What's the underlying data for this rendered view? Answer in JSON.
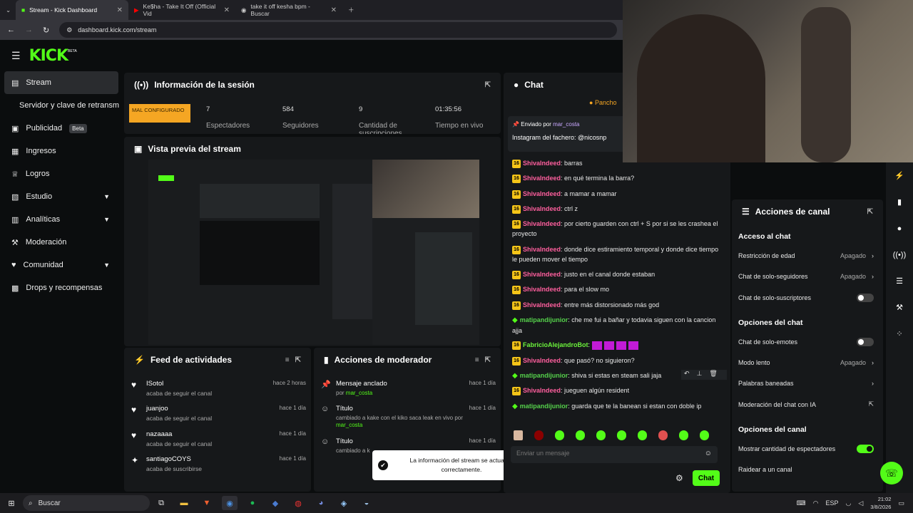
{
  "browser": {
    "tabs": [
      {
        "label": "Stream - Kick Dashboard",
        "active": true
      },
      {
        "label": "Ke$ha - Take It Off (Official Vid",
        "active": false
      },
      {
        "label": "take it off kesha bpm - Buscar",
        "active": false
      }
    ],
    "url": "dashboard.kick.com/stream"
  },
  "brand": {
    "logo": "KICK",
    "beta": "BETA",
    "accent": "#53fc18"
  },
  "sidebar": {
    "items": [
      {
        "label": "Stream",
        "icon": "stream-icon",
        "active": true
      },
      {
        "label": "Servidor y clave de retransm",
        "icon": "",
        "active": false
      },
      {
        "label": "Publicidad",
        "icon": "ad-icon",
        "badge": "Beta"
      },
      {
        "label": "Ingresos",
        "icon": "revenue-icon"
      },
      {
        "label": "Logros",
        "icon": "trophy-icon"
      },
      {
        "label": "Estudio",
        "icon": "studio-icon",
        "expand": true
      },
      {
        "label": "Analíticas",
        "icon": "analytics-icon",
        "expand": true
      },
      {
        "label": "Moderación",
        "icon": "mod-icon"
      },
      {
        "label": "Comunidad",
        "icon": "community-icon",
        "expand": true
      },
      {
        "label": "Drops y recompensas",
        "icon": "drops-icon"
      }
    ]
  },
  "session": {
    "title": "Información de la sesión",
    "warning": "MAL CONFIGURADO",
    "stats": [
      {
        "value": "7",
        "label": "Espectadores"
      },
      {
        "value": "584",
        "label": "Seguidores"
      },
      {
        "value": "9",
        "label": "Cantidad de suscripciones"
      },
      {
        "value": "01:35:56",
        "label": "Tiempo en vivo"
      }
    ]
  },
  "preview": {
    "title": "Vista previa del stream"
  },
  "feed": {
    "title": "Feed de actividades",
    "items": [
      {
        "name": "ISotol",
        "sub": "acaba de seguir el canal",
        "time": "hace 2 horas",
        "icon": "heart-icon"
      },
      {
        "name": "juanjoo",
        "sub": "acaba de seguir el canal",
        "time": "hace 1 día",
        "icon": "heart-icon"
      },
      {
        "name": "nazaaaa",
        "sub": "acaba de seguir el canal",
        "time": "hace 1 día",
        "icon": "heart-icon"
      },
      {
        "name": "santiagoCOYS",
        "sub": "acaba de suscribirse",
        "time": "hace 1 día",
        "icon": "star-icon"
      }
    ]
  },
  "mod_actions": {
    "title": "Acciones de moderador",
    "items": [
      {
        "name": "Mensaje anclado",
        "sub": "por",
        "user": "mar_costa",
        "time": "hace 1 día"
      },
      {
        "name": "Título",
        "sub": "cambiado a kake con el kiko saca leak en vivo por",
        "user": "mar_costa",
        "time": "hace 1 día"
      },
      {
        "name": "Título",
        "sub": "cambiado a k",
        "user": "",
        "time": "hace 1 día"
      }
    ]
  },
  "toast": {
    "text": "La información del stream se actualizó correctamente."
  },
  "chat": {
    "title": "Chat",
    "pinned_by_label": "Enviado por",
    "pinned_user": "mar_costa",
    "pinned_text": "Instagram del fachero: @nicosnp",
    "top_user": "Pancho",
    "messages": [
      {
        "badge": "16",
        "user": "ShivaIndeed",
        "text": "barras"
      },
      {
        "badge": "16",
        "user": "ShivaIndeed",
        "text": "en qué termina la barra?"
      },
      {
        "badge": "16",
        "user": "ShivaIndeed",
        "text": "a mamar a mamar"
      },
      {
        "badge": "16",
        "user": "ShivaIndeed",
        "text": "ctrl z"
      },
      {
        "badge": "16",
        "user": "ShivaIndeed",
        "text": "por cierto guarden con ctrl + S por si se les crashea el proyecto"
      },
      {
        "badge": "16",
        "user": "ShivaIndeed",
        "text": "donde dice estiramiento temporal y donde dice tiempo le pueden mover el tiempo"
      },
      {
        "badge": "16",
        "user": "ShivaIndeed",
        "text": "justo en el canal donde estaban"
      },
      {
        "badge": "16",
        "user": "ShivaIndeed",
        "text": "para el slow mo"
      },
      {
        "badge": "16",
        "user": "ShivaIndeed",
        "text": "entre más distorsionado más god"
      },
      {
        "badge": "dia",
        "user": "matipandijunior",
        "text": "che me fui a bañar y todavia siguen con la cancion ajja"
      },
      {
        "badge": "16",
        "user": "FabricioAlejandroBot",
        "text": ""
      },
      {
        "badge": "16",
        "user": "ShivaIndeed",
        "text": "que pasó? no siguieron?"
      },
      {
        "badge": "dia",
        "user": "matipandijunior",
        "text": "shiva si estas en steam sali jaja"
      },
      {
        "badge": "16",
        "user": "ShivaIndeed",
        "text": "jueguen algún resident"
      },
      {
        "badge": "dia",
        "user": "matipandijunior",
        "text": "guarda que te la banean si estan con doble ip"
      }
    ],
    "input_placeholder": "Enviar un mensaje",
    "send_label": "Chat"
  },
  "channel_actions": {
    "title": "Acciones de canal",
    "sections": [
      {
        "header": "Acceso al chat",
        "rows": [
          {
            "label": "Restricción de edad",
            "value": "Apagado",
            "kind": "arrow"
          },
          {
            "label": "Chat de solo-seguidores",
            "value": "Apagado",
            "kind": "arrow"
          },
          {
            "label": "Chat de solo-suscriptores",
            "value": "",
            "kind": "toggle-off"
          }
        ]
      },
      {
        "header": "Opciones del chat",
        "rows": [
          {
            "label": "Chat de solo-emotes",
            "value": "",
            "kind": "toggle-off"
          },
          {
            "label": "Modo lento",
            "value": "Apagado",
            "kind": "arrow"
          },
          {
            "label": "Palabras baneadas",
            "value": "",
            "kind": "arrow"
          },
          {
            "label": "Moderación del chat con IA",
            "value": "",
            "kind": "ext"
          }
        ]
      },
      {
        "header": "Opciones del canal",
        "rows": [
          {
            "label": "Mostrar cantidad de espectadores",
            "value": "",
            "kind": "toggle-on"
          },
          {
            "label": "Raidear a un canal",
            "value": "",
            "kind": "none"
          }
        ]
      }
    ]
  },
  "taskbar": {
    "search": "Buscar",
    "lang": "ESP",
    "time": "21:02",
    "date": "3/8/2026"
  }
}
